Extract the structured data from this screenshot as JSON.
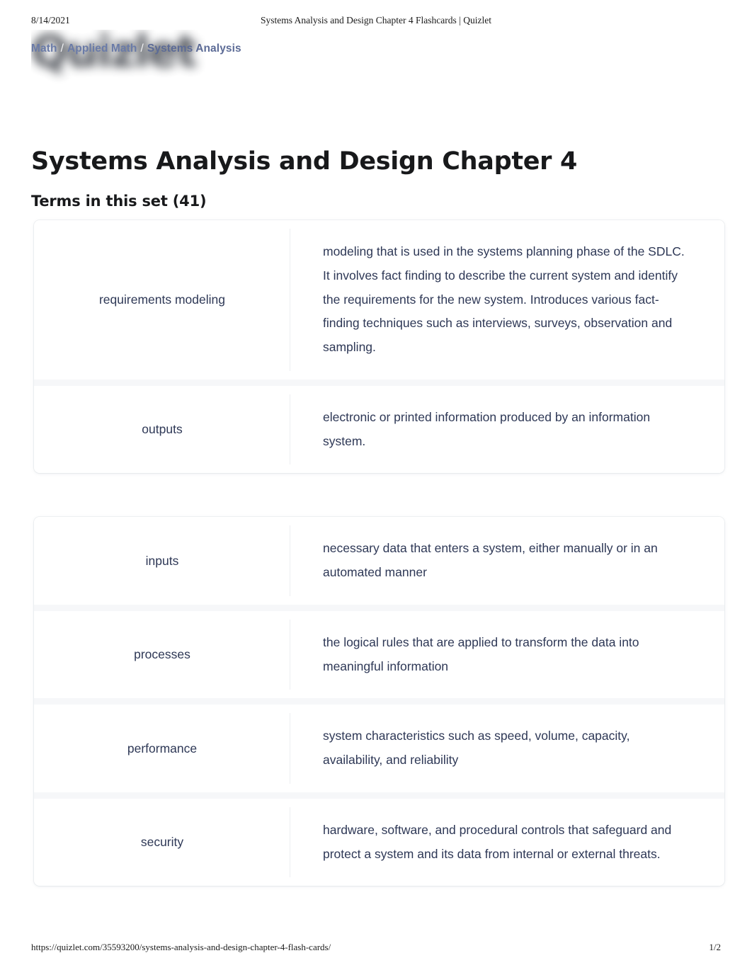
{
  "print_header": {
    "date": "8/14/2021",
    "document_title": "Systems Analysis and Design Chapter 4 Flashcards | Quizlet"
  },
  "logo": {
    "text": "Quizlet"
  },
  "breadcrumb": {
    "items": [
      {
        "label": "Math"
      },
      {
        "label": "Applied Math"
      },
      {
        "label": "Systems Analysis"
      }
    ],
    "separator": "/"
  },
  "page": {
    "set_title": "Systems Analysis and Design Chapter 4",
    "terms_heading": "Terms in this set (41)",
    "term_count": 41
  },
  "terms": {
    "groups": [
      {
        "rows": [
          {
            "term": "requirements modeling",
            "definition": "modeling that is used in the systems planning phase of the SDLC. It involves fact finding to describe the current system and identify the requirements for the new system. Introduces various fact-finding techniques such as interviews, surveys, observation and sampling."
          },
          {
            "term": "outputs",
            "definition": "electronic or printed information produced by an information system."
          }
        ]
      },
      {
        "rows": [
          {
            "term": "inputs",
            "definition": "necessary data that enters a system, either manually or in an automated manner"
          },
          {
            "term": "processes",
            "definition": "the logical rules that are applied to transform the data into meaningful information"
          },
          {
            "term": "performance",
            "definition": "system characteristics such as speed, volume, capacity, availability, and reliability"
          },
          {
            "term": "security",
            "definition": "hardware, software, and procedural controls that safeguard and protect a system and its data from internal or external threats."
          }
        ]
      }
    ]
  },
  "print_footer": {
    "url": "https://quizlet.com/35593200/systems-analysis-and-design-chapter-4-flash-cards/",
    "page_number": "1/2"
  },
  "colors": {
    "text_primary": "#2e3856",
    "heading": "#18191b",
    "breadcrumb_link": "#6a7ba8",
    "row_separator": "#f6f7f9",
    "card_background": "#ffffff",
    "page_background": "#ffffff"
  }
}
